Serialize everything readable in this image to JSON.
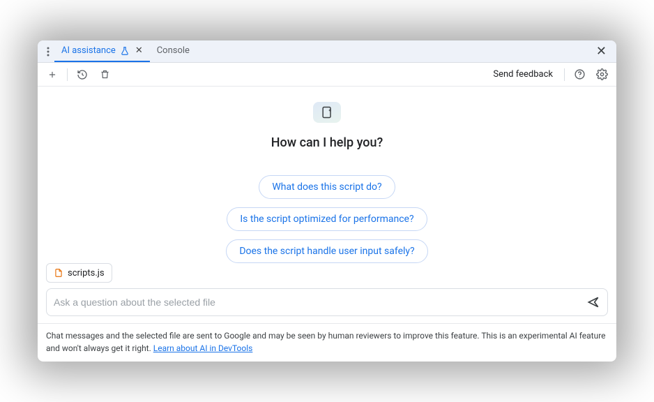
{
  "tabs": {
    "active": {
      "label": "AI assistance"
    },
    "inactive": {
      "label": "Console"
    }
  },
  "toolbar": {
    "feedback": "Send feedback"
  },
  "hero": {
    "heading": "How can I help you?"
  },
  "suggestions": [
    "What does this script do?",
    "Is the script optimized for performance?",
    "Does the script handle user input safely?"
  ],
  "context": {
    "file_name": "scripts.js"
  },
  "input": {
    "placeholder": "Ask a question about the selected file"
  },
  "disclaimer": {
    "text": "Chat messages and the selected file are sent to Google and may be seen by human reviewers to improve this feature. This is an experimental AI feature and won't always get it right. ",
    "link": "Learn about AI in DevTools"
  },
  "colors": {
    "accent": "#1a73e8",
    "file_icon": "#e8710a"
  }
}
